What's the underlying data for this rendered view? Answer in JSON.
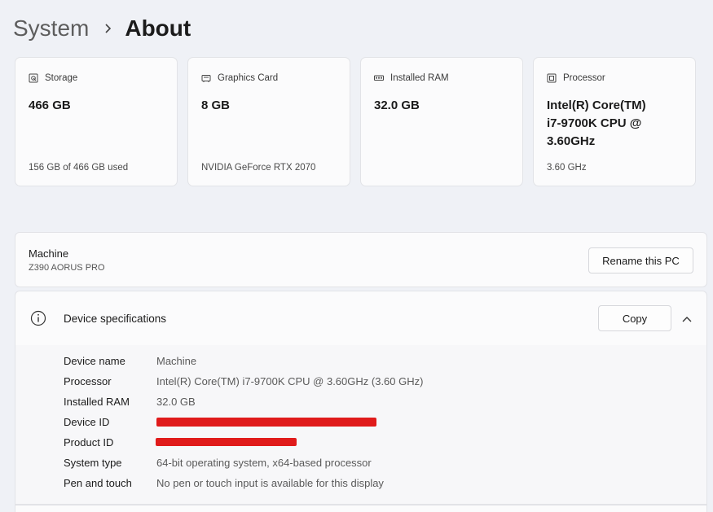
{
  "breadcrumb": {
    "parent": "System",
    "current": "About"
  },
  "cards": [
    {
      "icon": "storage-icon",
      "label": "Storage",
      "value": "466 GB",
      "sub": "156 GB of 466 GB used"
    },
    {
      "icon": "graphics-card-icon",
      "label": "Graphics Card",
      "value": "8 GB",
      "sub": "NVIDIA GeForce RTX 2070"
    },
    {
      "icon": "ram-icon",
      "label": "Installed RAM",
      "value": "32.0 GB",
      "sub": ""
    },
    {
      "icon": "processor-icon",
      "label": "Processor",
      "value": "Intel(R) Core(TM) i7-9700K CPU @ 3.60GHz",
      "sub": "3.60 GHz"
    }
  ],
  "machine": {
    "name": "Machine",
    "model": "Z390 AORUS PRO",
    "rename_label": "Rename this PC"
  },
  "specs": {
    "title": "Device specifications",
    "copy_label": "Copy",
    "rows": [
      {
        "label": "Device name",
        "value": "Machine"
      },
      {
        "label": "Processor",
        "value": "Intel(R) Core(TM) i7-9700K CPU @ 3.60GHz (3.60 GHz)"
      },
      {
        "label": "Installed RAM",
        "value": "32.0 GB"
      },
      {
        "label": "Device ID",
        "value": ""
      },
      {
        "label": "Product ID",
        "value": ""
      },
      {
        "label": "System type",
        "value": "64-bit operating system, x64-based processor"
      },
      {
        "label": "Pen and touch",
        "value": "No pen or touch input is available for this display"
      }
    ]
  },
  "colors": {
    "background": "#eff1f6",
    "card": "#fbfbfc",
    "redaction": "#e01b1b"
  }
}
